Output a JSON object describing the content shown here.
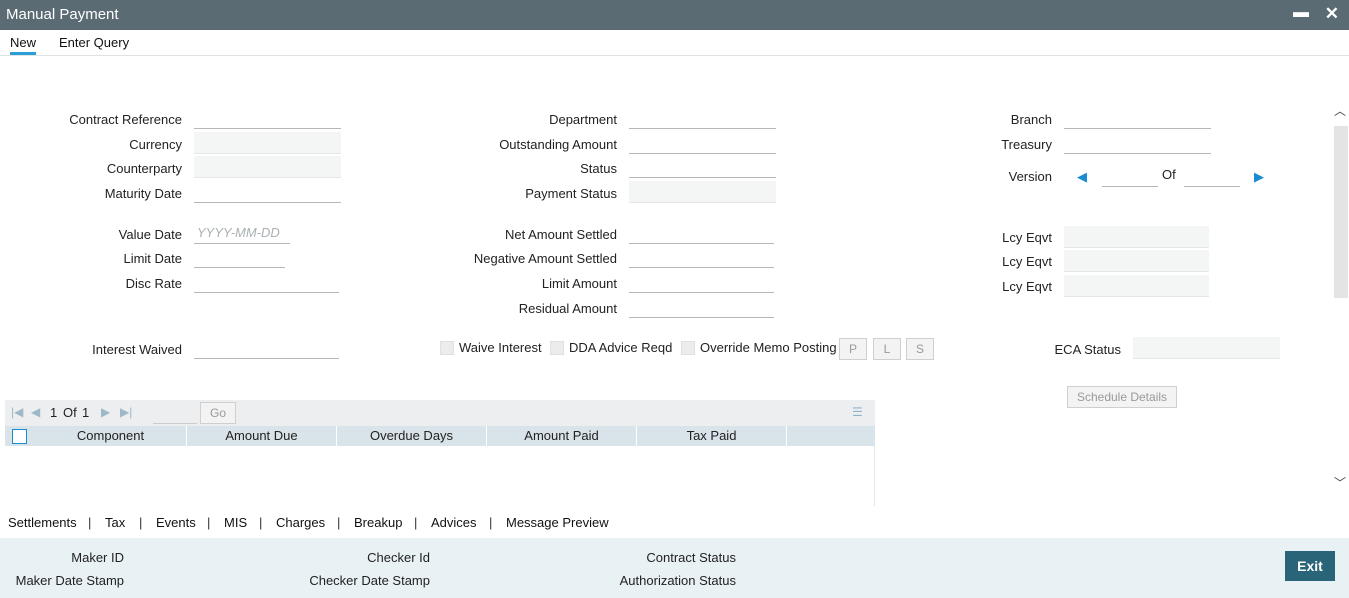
{
  "window": {
    "title": "Manual Payment",
    "minimize_glyph": "▬",
    "close_glyph": "✕"
  },
  "toolbar": {
    "new_label": "New",
    "enter_query_label": "Enter Query"
  },
  "form": {
    "contract_reference": {
      "label": "Contract Reference",
      "value": ""
    },
    "currency": {
      "label": "Currency",
      "value": ""
    },
    "counterparty": {
      "label": "Counterparty",
      "value": ""
    },
    "maturity_date": {
      "label": "Maturity Date",
      "value": ""
    },
    "value_date": {
      "label": "Value Date",
      "value": "",
      "placeholder": "YYYY-MM-DD"
    },
    "limit_date": {
      "label": "Limit Date",
      "value": ""
    },
    "disc_rate": {
      "label": "Disc Rate",
      "value": ""
    },
    "interest_waived": {
      "label": "Interest Waived",
      "value": ""
    },
    "department": {
      "label": "Department",
      "value": ""
    },
    "outstanding_amount": {
      "label": "Outstanding Amount",
      "value": ""
    },
    "status": {
      "label": "Status",
      "value": ""
    },
    "payment_status": {
      "label": "Payment Status",
      "value": ""
    },
    "net_amount_settled": {
      "label": "Net Amount Settled",
      "value": ""
    },
    "negative_amount_settled": {
      "label": "Negative Amount Settled",
      "value": ""
    },
    "limit_amount": {
      "label": "Limit Amount",
      "value": ""
    },
    "residual_amount": {
      "label": "Residual Amount",
      "value": ""
    },
    "branch": {
      "label": "Branch",
      "value": ""
    },
    "treasury": {
      "label": "Treasury",
      "value": ""
    },
    "version": {
      "label": "Version",
      "of_label": "Of",
      "value": "",
      "total": ""
    },
    "lcy_eqvt_1": {
      "label": "Lcy Eqvt",
      "value": ""
    },
    "lcy_eqvt_2": {
      "label": "Lcy Eqvt",
      "value": ""
    },
    "lcy_eqvt_3": {
      "label": "Lcy Eqvt",
      "value": ""
    },
    "eca_status": {
      "label": "ECA Status",
      "value": ""
    }
  },
  "checkboxes": {
    "waive_interest": "Waive Interest",
    "dda_advice_reqd": "DDA Advice Reqd",
    "override_memo_posting": "Override Memo Posting"
  },
  "small_buttons": {
    "p": "P",
    "l": "L",
    "s": "S"
  },
  "schedule_details_label": "Schedule Details",
  "grid": {
    "page_current": "1",
    "page_of": "Of",
    "page_total": "1",
    "go_label": "Go",
    "columns": [
      "Component",
      "Amount Due",
      "Overdue Days",
      "Amount Paid",
      "Tax Paid"
    ]
  },
  "subtabs": [
    "Settlements",
    "Tax",
    "Events",
    "MIS",
    "Charges",
    "Breakup",
    "Advices",
    "Message Preview"
  ],
  "footer": {
    "maker_id": "Maker ID",
    "maker_date_stamp": "Maker Date Stamp",
    "checker_id": "Checker Id",
    "checker_date_stamp": "Checker Date Stamp",
    "contract_status": "Contract Status",
    "authorization_status": "Authorization Status",
    "exit_label": "Exit"
  },
  "colors": {
    "titlebar": "#5b6b73",
    "accent": "#2a9fd6",
    "exit_button": "#2a6478",
    "footer_bg": "#e8f1f4"
  }
}
